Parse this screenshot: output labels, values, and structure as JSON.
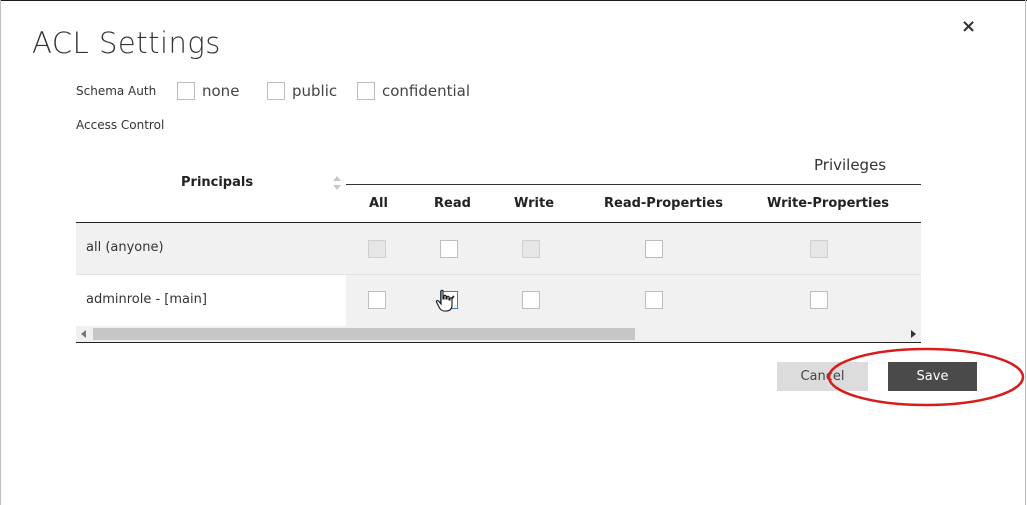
{
  "dialog": {
    "title": "ACL Settings",
    "close_glyph": "×"
  },
  "schema_auth": {
    "label": "Schema Auth",
    "options": [
      {
        "label": "none",
        "checked": false
      },
      {
        "label": "public",
        "checked": false
      },
      {
        "label": "confidential",
        "checked": false
      }
    ]
  },
  "access_control": {
    "label": "Access Control",
    "principals_header": "Principals",
    "privileges_header": "Privileges",
    "columns": [
      "All",
      "Read",
      "Write",
      "Read-Properties",
      "Write-Properties"
    ],
    "rows": [
      {
        "principal": "all (anyone)",
        "checks": [
          {
            "checked": false,
            "disabled": true
          },
          {
            "checked": false,
            "disabled": false
          },
          {
            "checked": false,
            "disabled": true
          },
          {
            "checked": false,
            "disabled": false
          },
          {
            "checked": false,
            "disabled": true
          }
        ]
      },
      {
        "principal": "adminrole - [main]",
        "checks": [
          {
            "checked": false,
            "disabled": false
          },
          {
            "checked": true,
            "disabled": false
          },
          {
            "checked": false,
            "disabled": false
          },
          {
            "checked": false,
            "disabled": false
          },
          {
            "checked": false,
            "disabled": false
          }
        ]
      }
    ]
  },
  "buttons": {
    "cancel": "Cancel",
    "save": "Save"
  },
  "colors": {
    "save_bg": "#4a4a4a",
    "cancel_bg": "#dcdcdc",
    "highlight": "#d81b1b"
  }
}
